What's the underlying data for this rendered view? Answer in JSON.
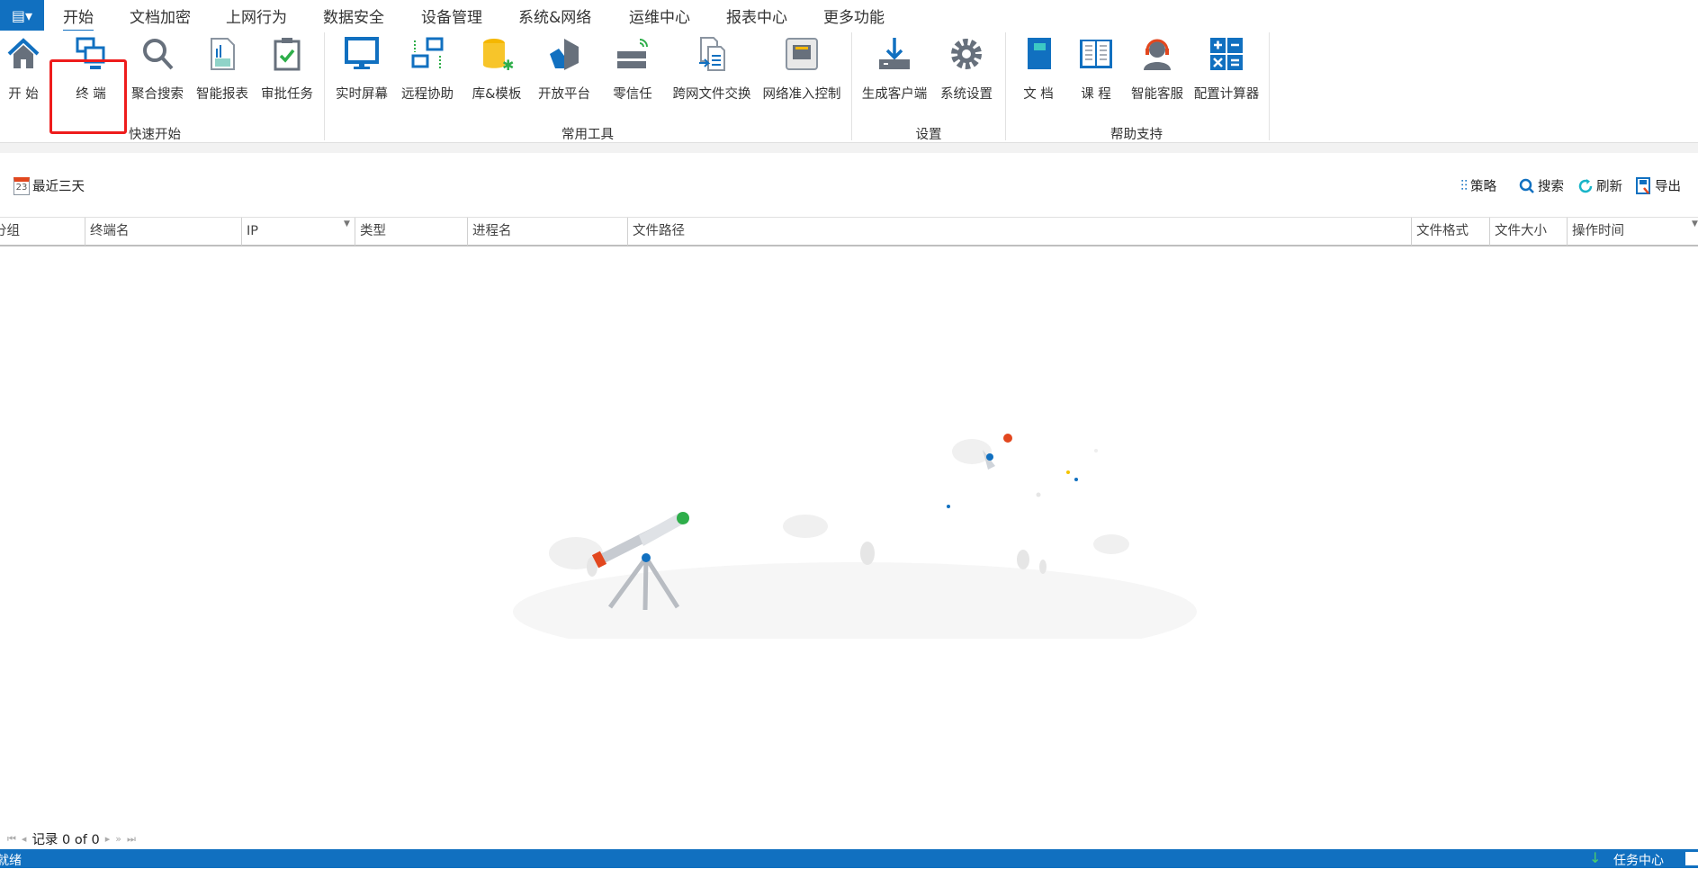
{
  "tabs": [
    "开始",
    "文档加密",
    "上网行为",
    "数据安全",
    "设备管理",
    "系统&网络",
    "运维中心",
    "报表中心",
    "更多功能"
  ],
  "ribbon": {
    "buttons": [
      "开 始",
      "终 端",
      "聚合搜索",
      "智能报表",
      "审批任务",
      "实时屏幕",
      "远程协助",
      "库&模板",
      "开放平台",
      "零信任",
      "跨网文件交换",
      "网络准入控制",
      "生成客户端",
      "系统设置",
      "文 档",
      "课 程",
      "智能客服",
      "配置计算器"
    ],
    "groups": [
      "快速开始",
      "常用工具",
      "设置",
      "帮助支持"
    ]
  },
  "toolbar": {
    "date_range": "最近三天",
    "date_icon_day": "23",
    "policy": "策略",
    "search": "搜索",
    "refresh": "刷新",
    "export": "导出"
  },
  "table": {
    "columns": [
      "分组",
      "终端名",
      "IP",
      "类型",
      "进程名",
      "文件路径",
      "文件格式",
      "文件大小",
      "操作时间"
    ],
    "rows": []
  },
  "pager": {
    "text": "记录 0 of 0"
  },
  "status": {
    "left": "就绪",
    "task_center": "任务中心"
  },
  "colors": {
    "accent": "#1170c0",
    "highlight": "#ee1c1c"
  }
}
